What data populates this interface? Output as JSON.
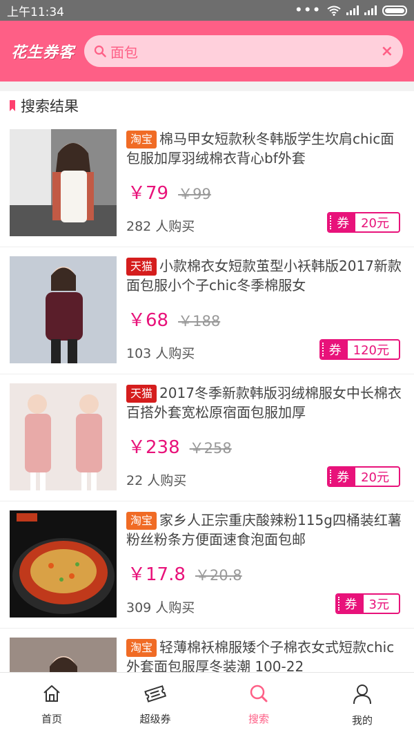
{
  "status_bar": {
    "time": "上午11:34"
  },
  "header": {
    "brand": "花生券客",
    "search_value": "面包",
    "clear_icon": "×"
  },
  "section": {
    "title": "搜索结果"
  },
  "colors": {
    "accent": "#fe5f86",
    "price": "#e8127a",
    "taobao": "#f06b25",
    "tmall": "#d51d1d"
  },
  "products": [
    {
      "platform": "淘宝",
      "platform_type": "taobao",
      "title": "棉马甲女短款秋冬韩版学生坎肩chic面包服加厚羽绒棉衣背心bf外套",
      "price": "￥79",
      "original_price": "￥99",
      "sold": "282 人购买",
      "coupon_label": "券",
      "coupon_value": "20元"
    },
    {
      "platform": "天猫",
      "platform_type": "tmall",
      "title": "小款棉衣女短款茧型小袄韩版2017新款面包服小个子chic冬季棉服女",
      "price": "￥68",
      "original_price": "￥188",
      "sold": "103 人购买",
      "coupon_label": "券",
      "coupon_value": "120元"
    },
    {
      "platform": "天猫",
      "platform_type": "tmall",
      "title": "2017冬季新款韩版羽绒棉服女中长棉衣百搭外套宽松原宿面包服加厚",
      "price": "￥238",
      "original_price": "￥258",
      "sold": "22 人购买",
      "coupon_label": "券",
      "coupon_value": "20元"
    },
    {
      "platform": "淘宝",
      "platform_type": "taobao",
      "title": "家乡人正宗重庆酸辣粉115g四桶装红薯粉丝粉条方便面速食泡面包邮",
      "price": "￥17.8",
      "original_price": "￥20.8",
      "sold": "309 人购买",
      "coupon_label": "券",
      "coupon_value": "3元"
    },
    {
      "platform": "淘宝",
      "platform_type": "taobao",
      "title": "轻薄棉袄棉服矮个子棉衣女式短款chic外套面包服厚冬装潮 100-22",
      "price": "",
      "original_price": "",
      "sold": "",
      "coupon_label": "",
      "coupon_value": ""
    }
  ],
  "tabs": [
    {
      "label": "首页",
      "icon": "home-icon"
    },
    {
      "label": "超级券",
      "icon": "ticket-icon"
    },
    {
      "label": "搜索",
      "icon": "search-icon",
      "active": true
    },
    {
      "label": "我的",
      "icon": "user-icon"
    }
  ]
}
